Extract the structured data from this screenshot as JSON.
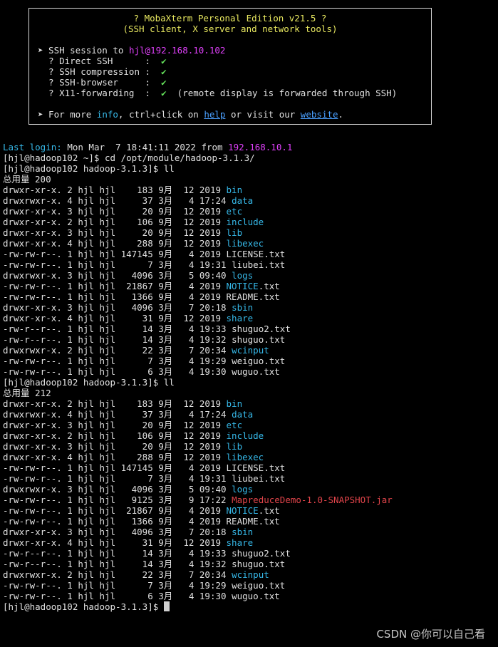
{
  "banner": {
    "title": "? MobaXterm Personal Edition v21.5 ?",
    "subtitle": "(SSH client, X server and network tools)",
    "session_prefix": "➤ SSH session to ",
    "session_target": "hjl@192.168.10.102",
    "features": [
      {
        "label": "  ? Direct SSH      :  ",
        "check": "✔",
        "note": ""
      },
      {
        "label": "  ? SSH compression :  ",
        "check": "✔",
        "note": ""
      },
      {
        "label": "  ? SSH-browser     :  ",
        "check": "✔",
        "note": ""
      },
      {
        "label": "  ? X11-forwarding  :  ",
        "check": "✔",
        "note": "  (remote display is forwarded through SSH)"
      }
    ],
    "more_prefix": "➤ For more ",
    "more_info": "info",
    "more_mid": ", ctrl+click on ",
    "more_help": "help",
    "more_mid2": " or visit our ",
    "more_website": "website",
    "more_end": "."
  },
  "login": {
    "label": "Last login:",
    "date": " Mon Mar  7 18:41:11 2022 from ",
    "ip": "192.168.10.1"
  },
  "commands": {
    "cd": "[hjl@hadoop102 ~]$ cd /opt/module/hadoop-3.1.3/",
    "ll1": "[hjl@hadoop102 hadoop-3.1.3]$ ll",
    "total1": "总用量 200",
    "ll2": "[hjl@hadoop102 hadoop-3.1.3]$ ll",
    "total2": "总用量 212",
    "final_prompt": "[hjl@hadoop102 hadoop-3.1.3]$ "
  },
  "listing1": [
    {
      "meta": "drwxr-xr-x. 2 hjl hjl    183 9月  12 2019 ",
      "name": "bin",
      "type": "dir"
    },
    {
      "meta": "drwxrwxr-x. 4 hjl hjl     37 3月   4 17:24 ",
      "name": "data",
      "type": "dir"
    },
    {
      "meta": "drwxr-xr-x. 3 hjl hjl     20 9月  12 2019 ",
      "name": "etc",
      "type": "dir"
    },
    {
      "meta": "drwxr-xr-x. 2 hjl hjl    106 9月  12 2019 ",
      "name": "include",
      "type": "dir"
    },
    {
      "meta": "drwxr-xr-x. 3 hjl hjl     20 9月  12 2019 ",
      "name": "lib",
      "type": "dir"
    },
    {
      "meta": "drwxr-xr-x. 4 hjl hjl    288 9月  12 2019 ",
      "name": "libexec",
      "type": "dir"
    },
    {
      "meta": "-rw-rw-r--. 1 hjl hjl 147145 9月   4 2019 ",
      "name": "LICENSE.txt",
      "type": "file"
    },
    {
      "meta": "-rw-rw-r--. 1 hjl hjl      7 3月   4 19:31 ",
      "name": "liubei.txt",
      "type": "file"
    },
    {
      "meta": "drwxrwxr-x. 3 hjl hjl   4096 3月   5 09:40 ",
      "name": "logs",
      "type": "dir"
    },
    {
      "meta": "-rw-rw-r--. 1 hjl hjl  21867 9月   4 2019 ",
      "name": "NOTICE",
      "suffix": ".txt",
      "type": "partial"
    },
    {
      "meta": "-rw-rw-r--. 1 hjl hjl   1366 9月   4 2019 ",
      "name": "README.txt",
      "type": "file"
    },
    {
      "meta": "drwxr-xr-x. 3 hjl hjl   4096 3月   7 20:18 ",
      "name": "sbin",
      "type": "dir"
    },
    {
      "meta": "drwxr-xr-x. 4 hjl hjl     31 9月  12 2019 ",
      "name": "share",
      "type": "dir"
    },
    {
      "meta": "-rw-r--r--. 1 hjl hjl     14 3月   4 19:33 ",
      "name": "shuguo2.txt",
      "type": "file"
    },
    {
      "meta": "-rw-r--r--. 1 hjl hjl     14 3月   4 19:32 ",
      "name": "shuguo.txt",
      "type": "file"
    },
    {
      "meta": "drwxrwxr-x. 2 hjl hjl     22 3月   7 20:34 ",
      "name": "wcinput",
      "type": "dir"
    },
    {
      "meta": "-rw-rw-r--. 1 hjl hjl      7 3月   4 19:29 ",
      "name": "weiguo.txt",
      "type": "file"
    },
    {
      "meta": "-rw-rw-r--. 1 hjl hjl      6 3月   4 19:30 ",
      "name": "wuguo.txt",
      "type": "file"
    }
  ],
  "listing2": [
    {
      "meta": "drwxr-xr-x. 2 hjl hjl    183 9月  12 2019 ",
      "name": "bin",
      "type": "dir"
    },
    {
      "meta": "drwxrwxr-x. 4 hjl hjl     37 3月   4 17:24 ",
      "name": "data",
      "type": "dir"
    },
    {
      "meta": "drwxr-xr-x. 3 hjl hjl     20 9月  12 2019 ",
      "name": "etc",
      "type": "dir"
    },
    {
      "meta": "drwxr-xr-x. 2 hjl hjl    106 9月  12 2019 ",
      "name": "include",
      "type": "dir"
    },
    {
      "meta": "drwxr-xr-x. 3 hjl hjl     20 9月  12 2019 ",
      "name": "lib",
      "type": "dir"
    },
    {
      "meta": "drwxr-xr-x. 4 hjl hjl    288 9月  12 2019 ",
      "name": "libexec",
      "type": "dir"
    },
    {
      "meta": "-rw-rw-r--. 1 hjl hjl 147145 9月   4 2019 ",
      "name": "LICENSE.txt",
      "type": "file"
    },
    {
      "meta": "-rw-rw-r--. 1 hjl hjl      7 3月   4 19:31 ",
      "name": "liubei.txt",
      "type": "file"
    },
    {
      "meta": "drwxrwxr-x. 3 hjl hjl   4096 3月   5 09:40 ",
      "name": "logs",
      "type": "dir"
    },
    {
      "meta": "-rw-rw-r--. 1 hjl hjl   9125 3月   9 17:22 ",
      "name": "MapreduceDemo-1.0-SNAPSHOT.jar",
      "type": "archive"
    },
    {
      "meta": "-rw-rw-r--. 1 hjl hjl  21867 9月   4 2019 ",
      "name": "NOTICE",
      "suffix": ".txt",
      "type": "partial"
    },
    {
      "meta": "-rw-rw-r--. 1 hjl hjl   1366 9月   4 2019 ",
      "name": "README.txt",
      "type": "file"
    },
    {
      "meta": "drwxr-xr-x. 3 hjl hjl   4096 3月   7 20:18 ",
      "name": "sbin",
      "type": "dir"
    },
    {
      "meta": "drwxr-xr-x. 4 hjl hjl     31 9月  12 2019 ",
      "name": "share",
      "type": "dir"
    },
    {
      "meta": "-rw-r--r--. 1 hjl hjl     14 3月   4 19:33 ",
      "name": "shuguo2.txt",
      "type": "file"
    },
    {
      "meta": "-rw-r--r--. 1 hjl hjl     14 3月   4 19:32 ",
      "name": "shuguo.txt",
      "type": "file"
    },
    {
      "meta": "drwxrwxr-x. 2 hjl hjl     22 3月   7 20:34 ",
      "name": "wcinput",
      "type": "dir"
    },
    {
      "meta": "-rw-rw-r--. 1 hjl hjl      7 3月   4 19:29 ",
      "name": "weiguo.txt",
      "type": "file"
    },
    {
      "meta": "-rw-rw-r--. 1 hjl hjl      6 3月   4 19:30 ",
      "name": "wuguo.txt",
      "type": "file"
    }
  ],
  "watermark": "CSDN @你可以自己看",
  "colors": {
    "background": "#000000",
    "text": "#e0e0e0",
    "dir": "#36b8e8",
    "archive": "#e0444a",
    "highlight": "#e040fb",
    "check": "#64e05a",
    "banner_title": "#e8e860"
  }
}
